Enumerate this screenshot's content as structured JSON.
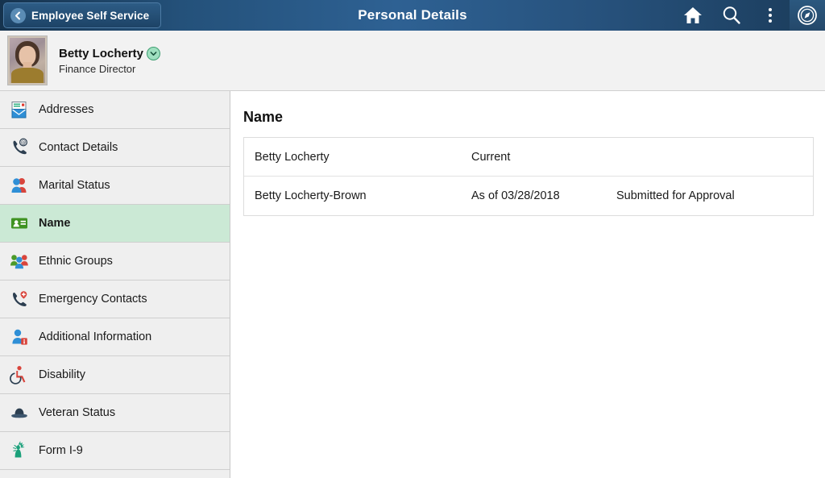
{
  "header": {
    "back_label": "Employee Self Service",
    "back_icon": "chevron-left-icon",
    "title": "Personal Details",
    "actions": [
      {
        "name": "home-icon",
        "label": "Home"
      },
      {
        "name": "search-icon",
        "label": "Search"
      },
      {
        "name": "actions-menu-icon",
        "label": "Actions"
      },
      {
        "name": "navigator-icon",
        "label": "Navigator"
      }
    ]
  },
  "employee": {
    "name": "Betty Locherty",
    "job_title": "Finance Director",
    "related_actions_icon": "chevron-down-circle-icon",
    "avatar_name": "employee-photo"
  },
  "sidebar": {
    "items": [
      {
        "label": "Addresses",
        "icon": "address-envelope-icon",
        "selected": false
      },
      {
        "label": "Contact Details",
        "icon": "phone-at-icon",
        "selected": false
      },
      {
        "label": "Marital Status",
        "icon": "two-people-icon",
        "selected": false
      },
      {
        "label": "Name",
        "icon": "name-badge-icon",
        "selected": true
      },
      {
        "label": "Ethnic Groups",
        "icon": "three-people-icon",
        "selected": false
      },
      {
        "label": "Emergency Contacts",
        "icon": "phone-medical-icon",
        "selected": false
      },
      {
        "label": "Additional Information",
        "icon": "person-info-icon",
        "selected": false
      },
      {
        "label": "Disability",
        "icon": "wheelchair-icon",
        "selected": false
      },
      {
        "label": "Veteran Status",
        "icon": "military-cap-icon",
        "selected": false
      },
      {
        "label": "Form I-9",
        "icon": "statue-of-liberty-icon",
        "selected": false
      }
    ]
  },
  "main": {
    "title": "Name",
    "rows": [
      {
        "name": "Betty Locherty",
        "effective": "Current",
        "status": ""
      },
      {
        "name": "Betty Locherty-Brown",
        "effective": "As of 03/28/2018",
        "status": "Submitted for Approval"
      }
    ]
  },
  "colors": {
    "header_blue": "#2e6193",
    "selected_green": "#cbe9d5",
    "sidebar_gray": "#efefef",
    "badge_green": "#9fe0c0"
  }
}
